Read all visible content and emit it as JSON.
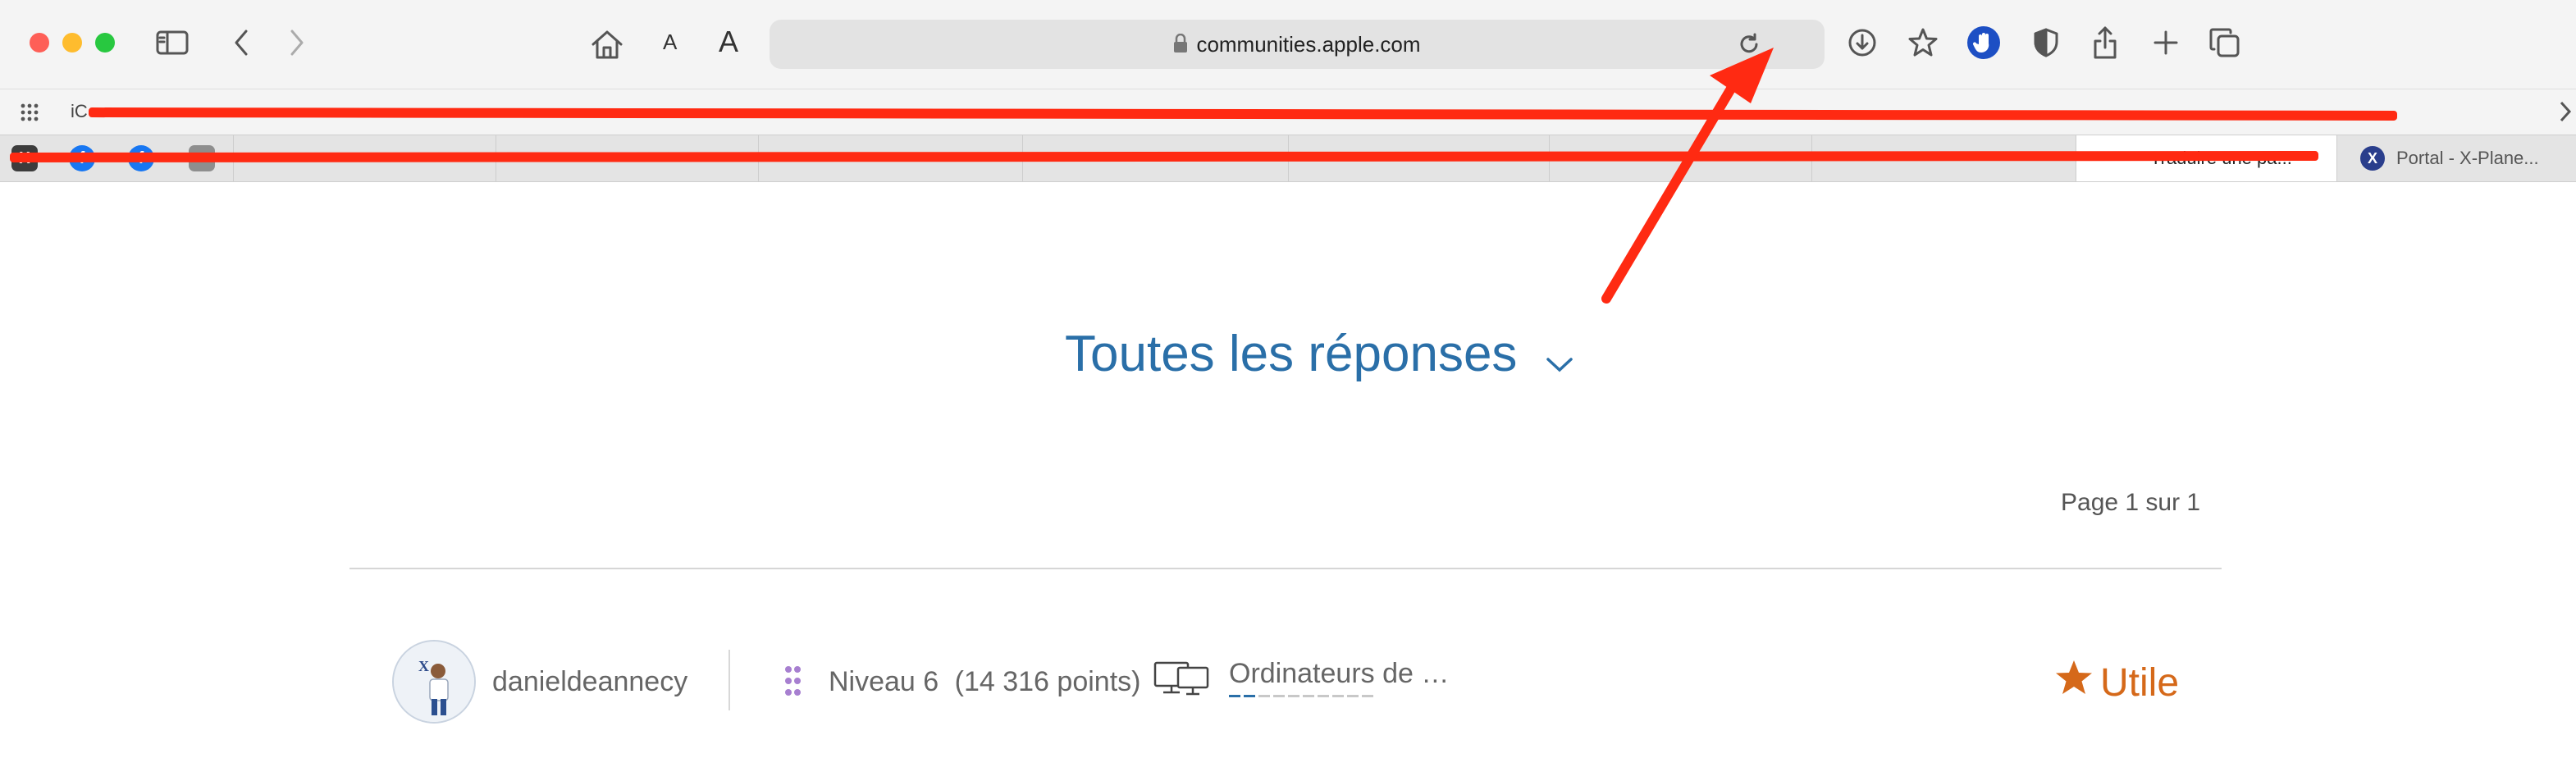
{
  "browser": {
    "address": "communities.apple.com",
    "text_size_small": "A",
    "text_size_large": "A"
  },
  "bookmarks": {
    "first_item": "iC"
  },
  "tabs": [
    {
      "label": "Traduire une pa..."
    },
    {
      "label": "Portal - X-Plane..."
    }
  ],
  "content": {
    "all_replies": "Toutes les réponses",
    "page_indicator": "Page 1 sur 1",
    "author": {
      "username": "danieldeannecy",
      "level": "Niveau 6",
      "points": "(14 316 points)",
      "device": "Ordinateurs de …"
    },
    "helpful_label": "Utile"
  },
  "colors": {
    "link_blue": "#2a6fa8",
    "helpful_orange": "#d5691a",
    "annotation_red": "#ff2a12"
  }
}
